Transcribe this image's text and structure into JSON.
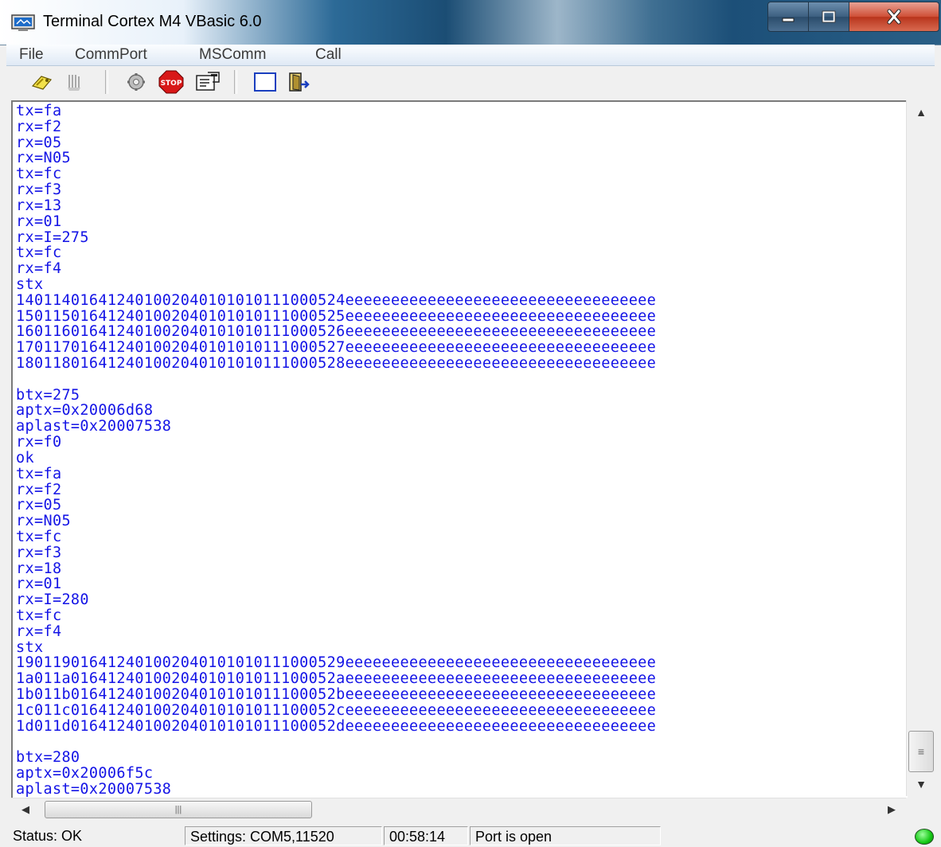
{
  "window": {
    "title": "Terminal Cortex M4 VBasic 6.0",
    "icon": "terminal-app-icon",
    "controls": [
      "minimize-icon",
      "maximize-icon",
      "close-icon"
    ]
  },
  "menu": {
    "items": [
      "File",
      "CommPort",
      "MSComm",
      "Call"
    ]
  },
  "toolbar": {
    "buttons": [
      "open-port-icon",
      "close-port-icon",
      "settings-gear-icon",
      "stop-icon",
      "properties-icon",
      "clear-screen-icon",
      "exit-icon"
    ]
  },
  "terminal": {
    "lines": [
      "tx=fa",
      "rx=f2",
      "rx=05",
      "rx=N05",
      "tx=fc",
      "rx=f3",
      "rx=13",
      "rx=01",
      "rx=I=275",
      "tx=fc",
      "rx=f4",
      "stx",
      "1401140164124010020401010101110005 24eeeeeeeeeeeeeeeeeeeeeeeeeeeeeeeeee",
      "150115016412401002040101010111000525eeeeeeeeeeeeeeeeeeeeeeeeeeeeeeeeee",
      "160116016412401002040101010111000526eeeeeeeeeeeeeeeeeeeeeeeeeeeeeeeeee",
      "170117016412401002040101010111000527eeeeeeeeeeeeeeeeeeeeeeeeeeeeeeeeee",
      "180118016412401002040101010111000528eeeeeeeeeeeeeeeeeeeeeeeeeeeeeeeeee",
      "",
      "btx=275",
      "aptx=0x20006d68",
      "aplast=0x20007538",
      "rx=f0",
      "ok",
      "tx=fa",
      "rx=f2",
      "rx=05",
      "rx=N05",
      "tx=fc",
      "rx=f3",
      "rx=18",
      "rx=01",
      "rx=I=280",
      "tx=fc",
      "rx=f4",
      "stx",
      "190119016412401002040101010111000529eeeeeeeeeeeeeeeeeeeeeeeeeeeeeeeeee",
      "1a011a01641240100204010101011100052aeeeeeeeeeeeeeeeeeeeeeeeeeeeeeeeeee",
      "1b011b01641240100204010101011100052beeeeeeeeeeeeeeeeeeeeeeeeeeeeeeeeee",
      "1c011c01641240100204010101011100052ceeeeeeeeeeeeeeeeeeeeeeeeeeeeeeeeee",
      "1d011d01641240100204010101011100052deeeeeeeeeeeeeeeeeeeeeeeeeeeeeeeeee",
      "",
      "btx=280",
      "aptx=0x20006f5c",
      "aplast=0x20007538"
    ],
    "text_color": "#1414e6"
  },
  "status": {
    "status_text": "Status: OK",
    "settings_text": "Settings: COM5,11520",
    "time_text": "00:58:14",
    "port_text": "Port is open",
    "indicator_color": "#14c814"
  }
}
